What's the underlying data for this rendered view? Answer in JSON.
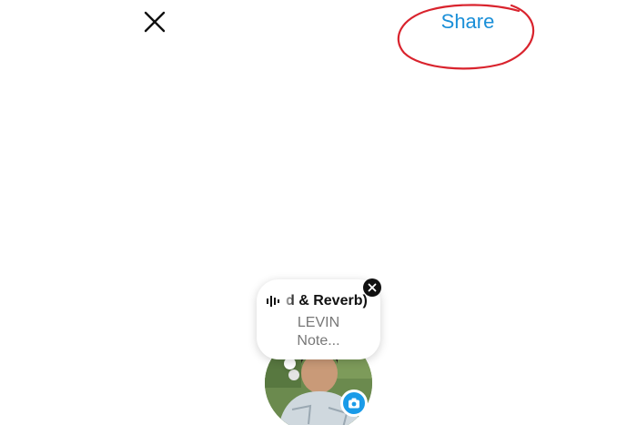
{
  "header": {
    "share_label": "Share",
    "close_icon": "close-icon",
    "annotation_color": "#d9232d",
    "share_color": "#1a8fd8"
  },
  "note": {
    "song_title": "d & Reverb)",
    "artist": "LEVIN",
    "text": "Note...",
    "music_icon": "waveform-icon",
    "remove_icon": "close-icon"
  },
  "profile": {
    "camera_icon": "camera-icon",
    "camera_color": "#1a9be8"
  }
}
